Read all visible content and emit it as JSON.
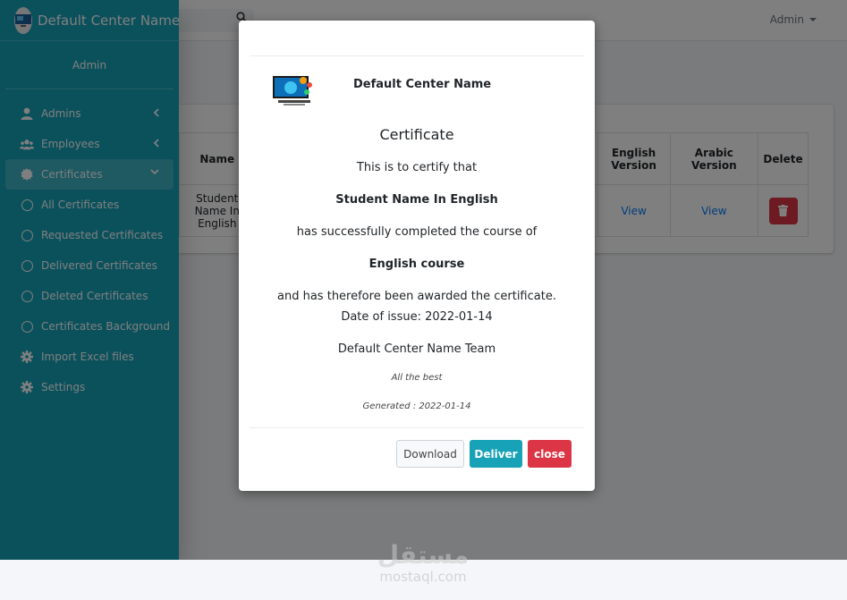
{
  "header": {
    "user_label": "Admin"
  },
  "sidebar": {
    "brand": "Default Center Name",
    "user": "Admin",
    "items": [
      {
        "label": "Admins",
        "icon": "user-icon"
      },
      {
        "label": "Employees",
        "icon": "users-icon"
      },
      {
        "label": "Certificates",
        "icon": "certificate-icon"
      },
      {
        "label": "All Certificates",
        "icon": "circle-icon"
      },
      {
        "label": "Requested Certificates",
        "icon": "circle-icon"
      },
      {
        "label": "Delivered Certificates",
        "icon": "circle-icon"
      },
      {
        "label": "Deleted Certificates",
        "icon": "circle-icon"
      },
      {
        "label": "Certificates Background",
        "icon": "circle-icon"
      },
      {
        "label": "Import Excel files",
        "icon": "gear-icon"
      },
      {
        "label": "Settings",
        "icon": "gear-icon"
      }
    ]
  },
  "table": {
    "headers": {
      "name": "Name",
      "english": "English Version",
      "arabic": "Arabic Version",
      "delete": "Delete"
    },
    "rows": [
      {
        "name": "Student Name In English",
        "english": "View",
        "arabic": "View"
      }
    ]
  },
  "modal": {
    "center_name": "Default Center Name",
    "title": "Certificate",
    "intro": "This is to certify that",
    "student": "Student Name In English",
    "completed": "has successfully completed the course of",
    "course": "English course",
    "awarded": "and has therefore been awarded the certificate.",
    "date_of_issue": "Date of issue: 2022-01-14",
    "team": "Default Center Name Team",
    "wish": "All the best",
    "generated": "Generated : 2022-01-14",
    "buttons": {
      "download": "Download",
      "deliver": "Deliver",
      "close": "close"
    }
  },
  "watermark": {
    "arabic": "مستقل",
    "latin": "mostaql.com"
  },
  "colors": {
    "sidebar": "#17a2b8",
    "deliver": "#17a2b8",
    "danger": "#dc3545",
    "link": "#007bff"
  }
}
